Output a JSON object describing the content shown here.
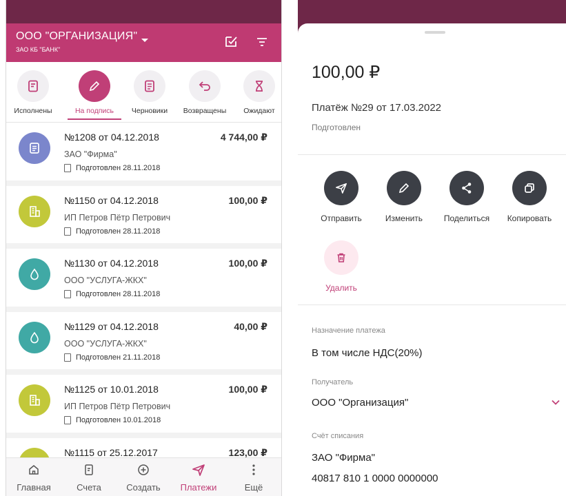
{
  "left": {
    "header": {
      "org": "ООО \"ОРГАНИЗАЦИЯ\"",
      "bank": "ЗАО КБ \"БАНК\""
    },
    "tabs": [
      {
        "label": "Исполнены",
        "icon": "doc-check-icon"
      },
      {
        "label": "На подпись",
        "icon": "pen-icon",
        "active": true
      },
      {
        "label": "Черновики",
        "icon": "doc-list-icon"
      },
      {
        "label": "Возвращены",
        "icon": "return-arrow-icon"
      },
      {
        "label": "Ожидают",
        "icon": "hourglass-icon"
      }
    ],
    "payments": [
      {
        "title": "№1208 от 04.12.2018",
        "amount": "4 744,00 ₽",
        "payee": "ЗАО \"Фирма\"",
        "status": "Подготовлен 28.11.2018",
        "icon_color": "#7b86cc",
        "icon": "document-icon"
      },
      {
        "title": "№1150 от 04.12.2018",
        "amount": "100,00 ₽",
        "payee": "ИП Петров Пётр Петрович",
        "status": "Подготовлен 28.11.2018",
        "icon_color": "#c2c83a",
        "icon": "building-icon"
      },
      {
        "title": "№1130 от 04.12.2018",
        "amount": "100,00 ₽",
        "payee": "ООО \"УСЛУГА-ЖКХ\"",
        "status": "Подготовлен 28.11.2018",
        "icon_color": "#40a9a5",
        "icon": "drop-icon"
      },
      {
        "title": "№1129 от 04.12.2018",
        "amount": "40,00 ₽",
        "payee": "ООО \"УСЛУГА-ЖКХ\"",
        "status": "Подготовлен 21.11.2018",
        "icon_color": "#40a9a5",
        "icon": "drop-icon"
      },
      {
        "title": "№1125 от 10.01.2018",
        "amount": "100,00 ₽",
        "payee": "ИП Петров Пётр Петрович",
        "status": "Подготовлен 10.01.2018",
        "icon_color": "#c2c83a",
        "icon": "building-icon"
      },
      {
        "title": "№1115 от 25.12.2017",
        "amount": "123,00 ₽",
        "payee": "",
        "status": "",
        "icon_color": "#c2c83a",
        "icon": "building-icon"
      }
    ],
    "nav": [
      {
        "label": "Главная",
        "icon": "home-icon"
      },
      {
        "label": "Счета",
        "icon": "accounts-icon"
      },
      {
        "label": "Создать",
        "icon": "plus-circle-icon"
      },
      {
        "label": "Платежи",
        "icon": "send-icon",
        "active": true
      },
      {
        "label": "Ещё",
        "icon": "more-icon"
      }
    ]
  },
  "right": {
    "amount": "100,00 ₽",
    "title": "Платёж №29 от 17.03.2022",
    "status": "Подготовлен",
    "actions": [
      {
        "label": "Отправить",
        "icon": "send-icon"
      },
      {
        "label": "Изменить",
        "icon": "pen-icon"
      },
      {
        "label": "Поделиться",
        "icon": "share-icon"
      },
      {
        "label": "Копировать",
        "icon": "copy-icon"
      }
    ],
    "delete_label": "Удалить",
    "purpose_label": "Назначение платежа",
    "purpose_value": "В том числе НДС(20%)",
    "recipient_label": "Получатель",
    "recipient_value": "ООО \"Организация\"",
    "account_label": "Счёт списания",
    "account_name": "ЗАО \"Фирма\"",
    "account_number": "40817 810 1 0000 0000000"
  },
  "colors": {
    "accent": "#c03f77",
    "header": "#bf3a72",
    "statusbar": "#6e2748",
    "action_dark": "#3c3f46"
  }
}
